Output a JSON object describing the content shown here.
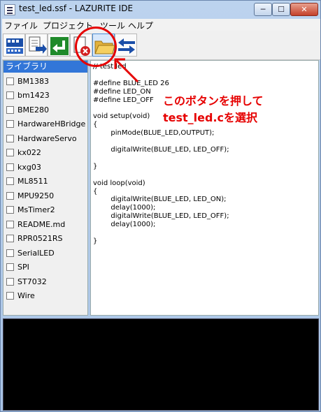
{
  "window": {
    "title": "test_led.ssf - LAZURITE IDE"
  },
  "window_controls": {
    "minimize": "─",
    "maximize": "☐",
    "close": "✕"
  },
  "menu": {
    "items": [
      "ファイル",
      "プロジェクト",
      "ツール",
      "ヘルプ"
    ]
  },
  "sidebar": {
    "header": "ライブラリ",
    "items": [
      "BM1383",
      "bm1423",
      "BME280",
      "HardwareHBridge",
      "HardwareServo",
      "kx022",
      "kxg03",
      "ML8511",
      "MPU9250",
      "MsTimer2",
      "README.md",
      "RPR0521RS",
      "SerialLED",
      "SPI",
      "ST7032",
      "Wire"
    ]
  },
  "editor": {
    "lines": [
      "// test led",
      "",
      "#define BLUE_LED 26",
      "#define LED_ON",
      "#define LED_OFF",
      "",
      "void setup(void)",
      "{",
      "        pinMode(BLUE_LED,OUTPUT);",
      "",
      "        digitalWrite(BLUE_LED, LED_OFF);",
      "",
      "}",
      "",
      "void loop(void)",
      "{",
      "        digitalWrite(BLUE_LED, LED_ON);",
      "        delay(1000);",
      "        digitalWrite(BLUE_LED, LED_OFF);",
      "        delay(1000);",
      "",
      "}"
    ]
  },
  "annotation": {
    "line1": "このボタンを押して",
    "line2": "test_led.cを選択",
    "color": "#e60000"
  },
  "colors": {
    "sidebar_header": "#3276d8",
    "output_bg": "#000000"
  }
}
